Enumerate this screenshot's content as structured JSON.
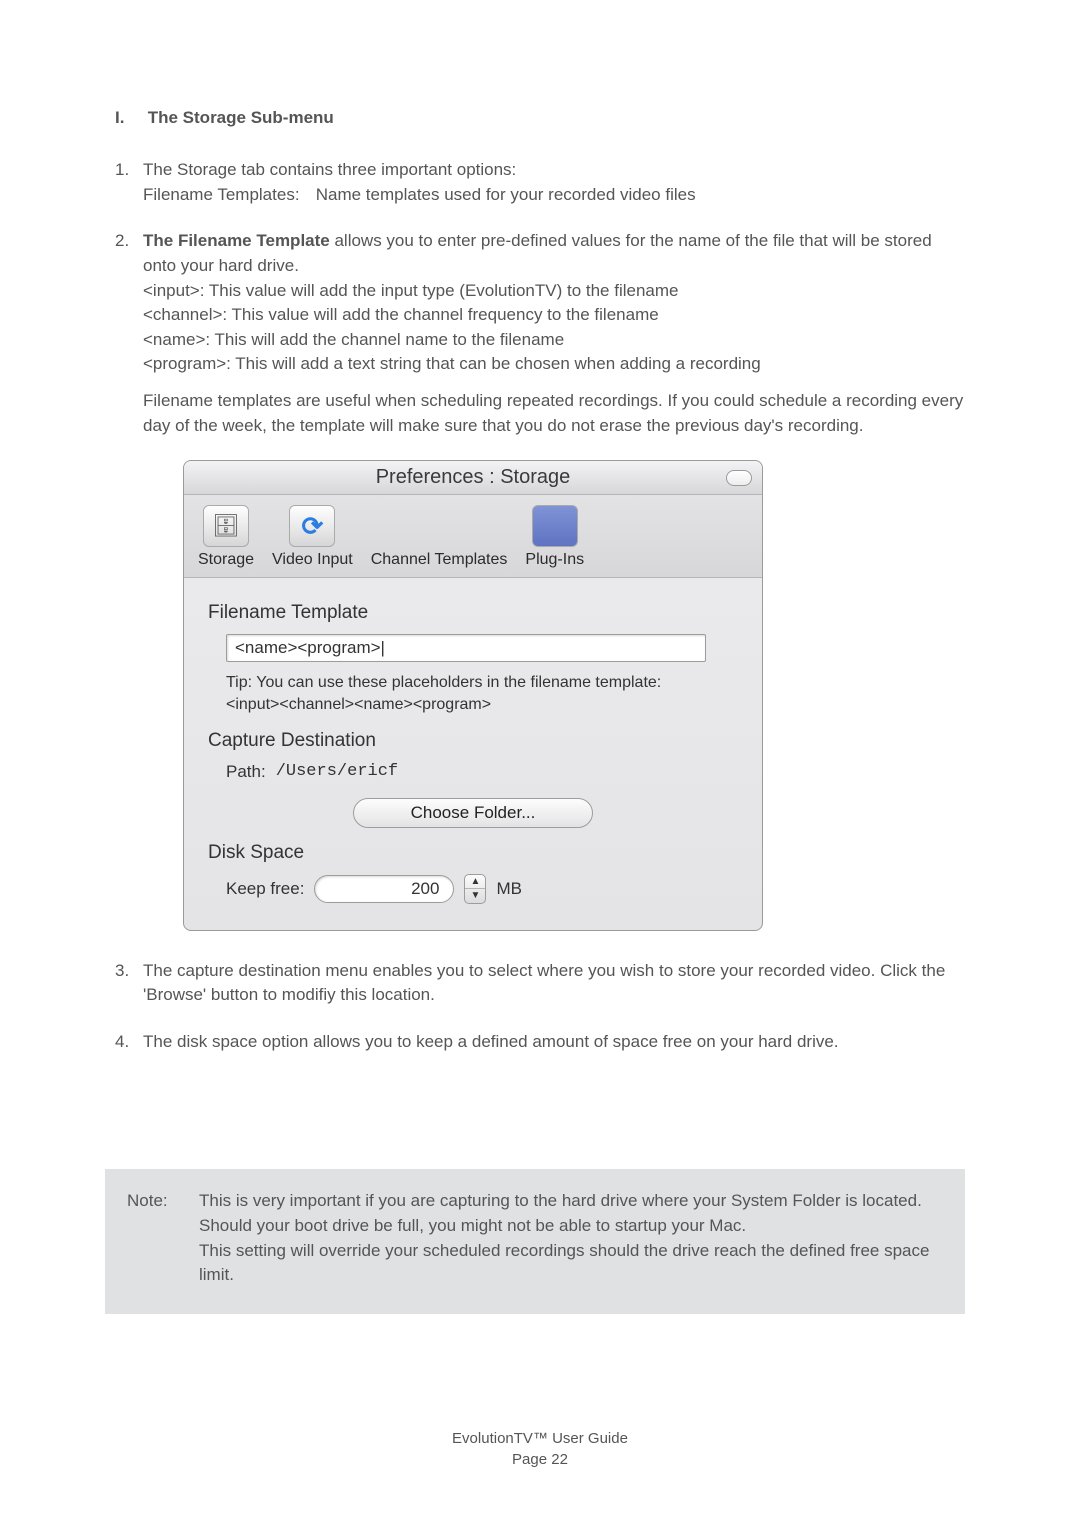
{
  "section": {
    "num": "I.",
    "title": "The Storage Sub-menu"
  },
  "items": {
    "i1": {
      "n": "1.",
      "line1": "The Storage tab contains three important options:",
      "label": "Filename Templates:",
      "desc": "Name templates used for your recorded video files"
    },
    "i2": {
      "n": "2.",
      "lead_bold": "The Filename Template",
      "lead_rest": " allows you to enter pre-defined values for the name of the file that will be stored onto your hard drive.",
      "p_input": "<input>: This value will add the input type (EvolutionTV) to the filename",
      "p_channel": "<channel>: This value will add the channel frequency to the filename",
      "p_name": "<name>: This will add the channel name to the filename",
      "p_program": "<program>: This will add a text string that can be chosen when adding a recording",
      "para2": "Filename templates are useful when scheduling repeated recordings. If you could schedule a recording every day of the week, the template will make sure that you do not erase the previous day's recording."
    },
    "i3": {
      "n": "3.",
      "text": "The capture destination menu enables you to select where you wish to store your recorded video. Click the 'Browse' button to modifiy this location."
    },
    "i4": {
      "n": "4.",
      "text": "The disk space option allows you to keep a defined amount of space free on your hard drive."
    }
  },
  "window": {
    "title": "Preferences : Storage",
    "tabs": {
      "storage": "Storage",
      "video": "Video Input",
      "channels": "Channel Templates",
      "plugins": "Plug-Ins"
    },
    "filename_template": {
      "heading": "Filename Template",
      "value": "<name><program>",
      "tip_line1": "Tip: You can use these placeholders in the filename template:",
      "tip_line2": "<input><channel><name><program>"
    },
    "capture": {
      "heading": "Capture Destination",
      "path_label": "Path:",
      "path_value": "/Users/ericf",
      "button": "Choose Folder..."
    },
    "disk": {
      "heading": "Disk Space",
      "keep_label": "Keep free:",
      "value": "200",
      "unit": "MB"
    }
  },
  "note": {
    "label": "Note:",
    "text": "This is very important if you are capturing to the hard drive where your System Folder is located. Should your boot drive be full, you might not be able to startup your Mac.\nThis setting will override your scheduled recordings should the drive reach the defined free space limit."
  },
  "footer": {
    "line1": "EvolutionTV™ User Guide",
    "line2_pre": "Page ",
    "page": "22"
  }
}
